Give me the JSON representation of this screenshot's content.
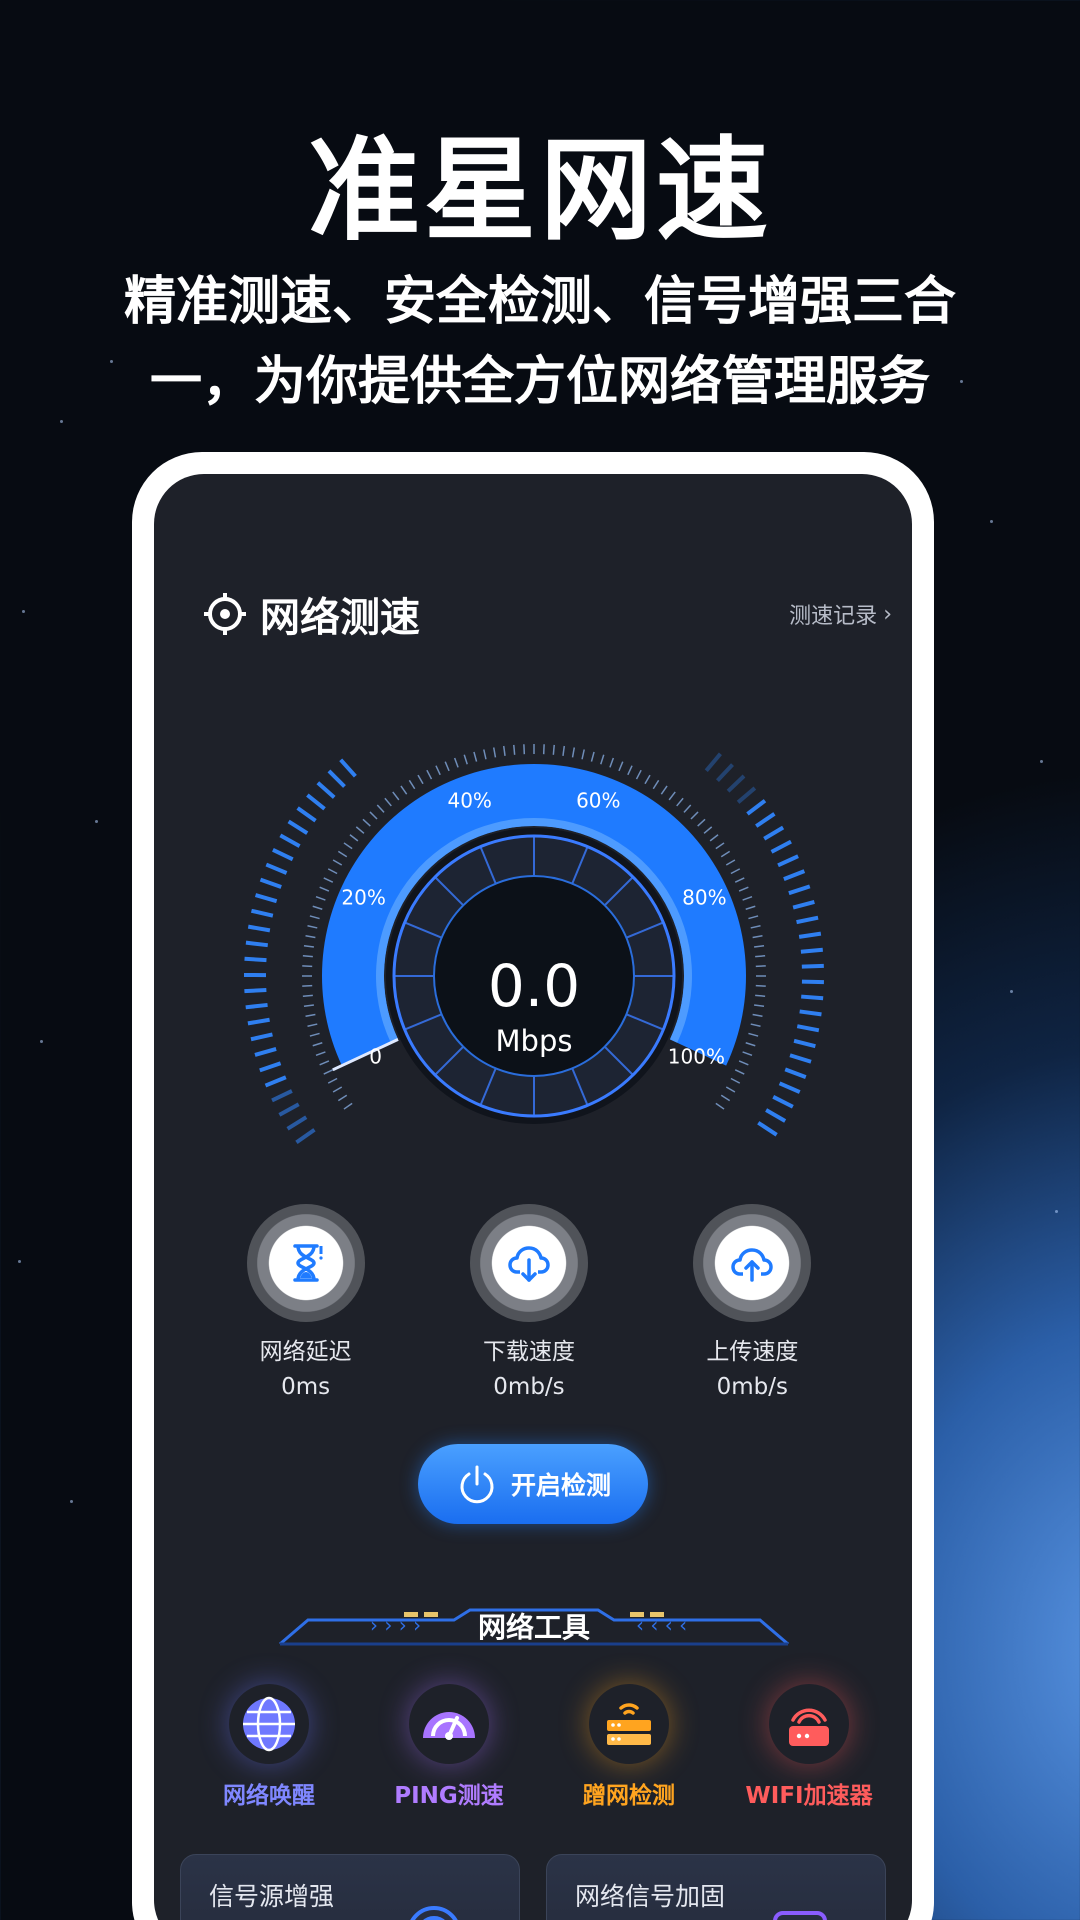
{
  "hero": {
    "title": "准星网速",
    "subtitle_line1": "精准测速、安全检测、信号增强三合",
    "subtitle_line2": "一，为你提供全方位网络管理服务"
  },
  "header": {
    "title": "网络测速",
    "title_icon": "crosshair-icon",
    "history_link": "测速记录",
    "history_chevron": "›"
  },
  "gauge": {
    "value": "0.0",
    "unit": "Mbps",
    "tick_labels": [
      "0",
      "20%",
      "40%",
      "60%",
      "80%",
      "100%"
    ]
  },
  "stats": [
    {
      "label": "网络延迟",
      "value": "0ms",
      "icon": "hourglass-icon"
    },
    {
      "label": "下载速度",
      "value": "0mb/s",
      "icon": "cloud-download-icon"
    },
    {
      "label": "上传速度",
      "value": "0mb/s",
      "icon": "cloud-upload-icon"
    }
  ],
  "start_button": {
    "label": "开启检测",
    "icon": "power-icon"
  },
  "tools_section": {
    "title": "网络工具"
  },
  "tools": [
    {
      "label": "网络唤醒",
      "icon": "globe-icon",
      "color": "#6f78ff"
    },
    {
      "label": "PING测速",
      "icon": "speedometer-icon",
      "color": "#a874ff"
    },
    {
      "label": "蹭网检测",
      "icon": "router-icon",
      "color": "#ffa41f"
    },
    {
      "label": "WIFI加速器",
      "icon": "wifi-router-icon",
      "color": "#ff5c5c"
    }
  ],
  "cards": [
    {
      "title": "信号源增强"
    },
    {
      "title": "网络信号加固"
    }
  ],
  "colors": {
    "accent": "#1f7bff",
    "screen_bg": "#1e2129"
  }
}
